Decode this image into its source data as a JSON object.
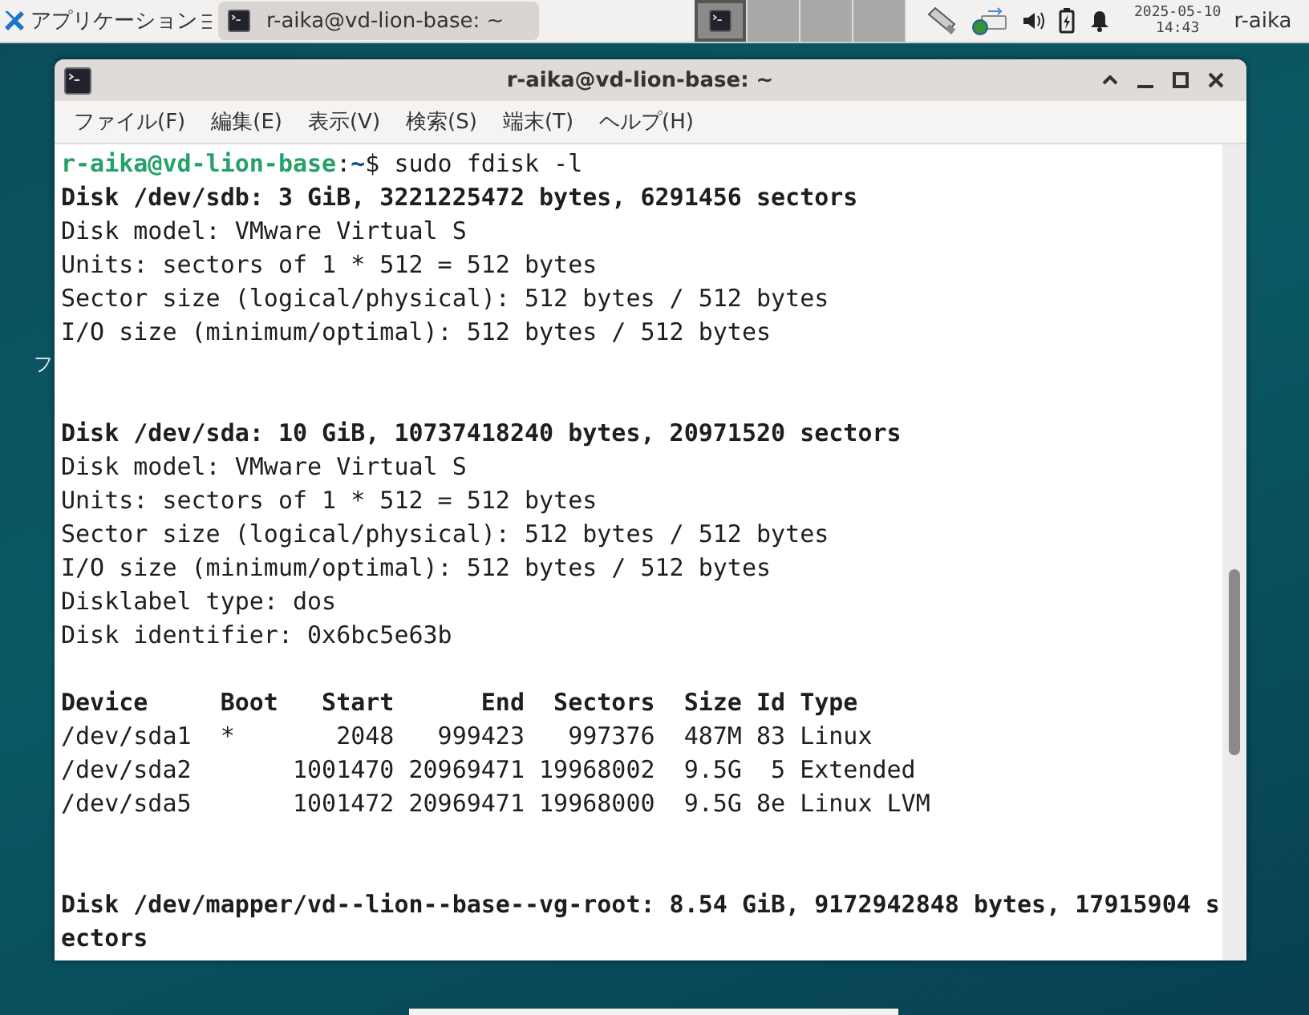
{
  "taskbar": {
    "app_menu": "アプリケーション",
    "tasks": [
      {
        "label": "r-aika@vd-lion-base: ~",
        "selected": true
      }
    ],
    "workspaces": [
      {
        "selected": true
      },
      {
        "selected": false
      },
      {
        "selected": false
      },
      {
        "selected": false
      }
    ],
    "clock": {
      "date": "2025-05-10",
      "time": "14:43"
    },
    "user": "r-aika"
  },
  "desktop": {
    "icon_label": "フ"
  },
  "window": {
    "title": "r-aika@vd-lion-base: ~",
    "menu": [
      "ファイル(F)",
      "編集(E)",
      "表示(V)",
      "検索(S)",
      "端末(T)",
      "ヘルプ(H)"
    ],
    "terminal": {
      "lines": [
        {
          "kind": "prompt",
          "user_host": "r-aika@vd-lion-base",
          "separator": ":",
          "path": "~",
          "command": "$ sudo fdisk -l"
        },
        {
          "kind": "bold",
          "text": "Disk /dev/sdb: 3 GiB, 3221225472 bytes, 6291456 sectors"
        },
        {
          "kind": "plain",
          "text": "Disk model: VMware Virtual S"
        },
        {
          "kind": "plain",
          "text": "Units: sectors of 1 * 512 = 512 bytes"
        },
        {
          "kind": "plain",
          "text": "Sector size (logical/physical): 512 bytes / 512 bytes"
        },
        {
          "kind": "plain",
          "text": "I/O size (minimum/optimal): 512 bytes / 512 bytes"
        },
        {
          "kind": "blank"
        },
        {
          "kind": "blank"
        },
        {
          "kind": "bold",
          "text": "Disk /dev/sda: 10 GiB, 10737418240 bytes, 20971520 sectors"
        },
        {
          "kind": "plain",
          "text": "Disk model: VMware Virtual S"
        },
        {
          "kind": "plain",
          "text": "Units: sectors of 1 * 512 = 512 bytes"
        },
        {
          "kind": "plain",
          "text": "Sector size (logical/physical): 512 bytes / 512 bytes"
        },
        {
          "kind": "plain",
          "text": "I/O size (minimum/optimal): 512 bytes / 512 bytes"
        },
        {
          "kind": "plain",
          "text": "Disklabel type: dos"
        },
        {
          "kind": "plain",
          "text": "Disk identifier: 0x6bc5e63b"
        },
        {
          "kind": "blank"
        },
        {
          "kind": "bold",
          "text": "Device     Boot   Start      End  Sectors  Size Id Type"
        },
        {
          "kind": "plain",
          "text": "/dev/sda1  *       2048   999423   997376  487M 83 Linux"
        },
        {
          "kind": "plain",
          "text": "/dev/sda2       1001470 20969471 19968002  9.5G  5 Extended"
        },
        {
          "kind": "plain",
          "text": "/dev/sda5       1001472 20969471 19968000  9.5G 8e Linux LVM"
        },
        {
          "kind": "blank"
        },
        {
          "kind": "blank"
        },
        {
          "kind": "bold",
          "text": "Disk /dev/mapper/vd--lion--base--vg-root: 8.54 GiB, 9172942848 bytes, 17915904 s"
        },
        {
          "kind": "bold",
          "text": "ectors"
        }
      ]
    }
  }
}
